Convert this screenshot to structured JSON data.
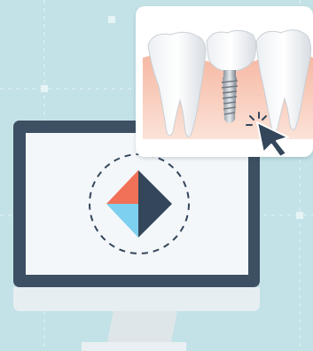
{
  "scene": {
    "icons": [
      "monitor-icon",
      "diamond-logo-icon",
      "dental-implant-icon",
      "cursor-arrow-icon",
      "click-burst-icon"
    ],
    "colors": {
      "background": "#c3e2e7",
      "monitor_frame": "#3d4f62",
      "monitor_screen": "#f4f7fa",
      "monitor_bezel": "#e7eef2",
      "logo_orange": "#f07158",
      "logo_blue": "#7dd0ef",
      "logo_navy": "#34465a",
      "gum": "#f2a993"
    }
  }
}
